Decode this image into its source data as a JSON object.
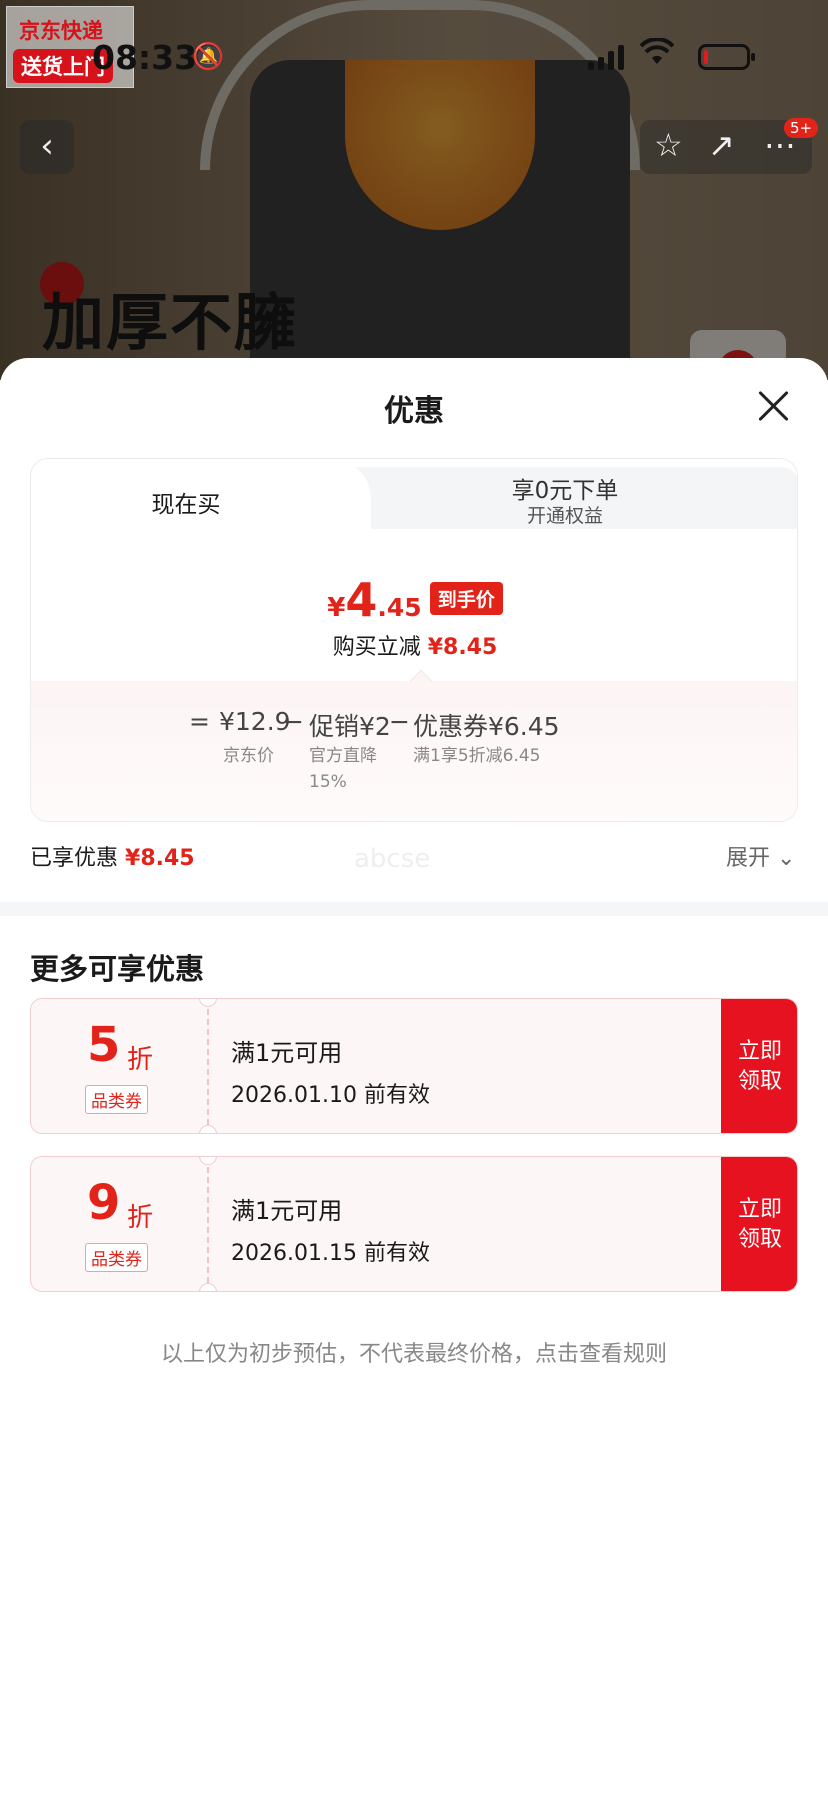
{
  "status_bar": {
    "time": "08:33"
  },
  "jd_badge": {
    "line1": "京东快递",
    "line2": "送货上门"
  },
  "product_banner": {
    "headline": "加厚不臃"
  },
  "cart_badge": "5+",
  "sheet": {
    "title": "优惠",
    "tabs": {
      "buy_now": "现在买",
      "zero_title": "享0元下单",
      "zero_sub": "开通权益"
    },
    "price": {
      "yen": "¥",
      "int": "4",
      "dec": ".45",
      "tag": "到手价"
    },
    "save_prefix": "购买立减",
    "save_amount": "¥8.45",
    "formula": {
      "eq": "=",
      "base": "¥12.9",
      "base_label": "京东价",
      "minus1": "−",
      "promo": "促销¥2",
      "promo_label_1": "官方直降",
      "promo_label_2": "15%",
      "minus2": "−",
      "coupon": "优惠券¥6.45",
      "coupon_label": "满1享5折减6.45"
    },
    "enjoyed_label": "已享优惠",
    "enjoyed_amount": "¥8.45",
    "expand_label": "展开",
    "watermark": "abcse",
    "more_title": "更多可享优惠",
    "coupons": [
      {
        "num": "5",
        "unit": "折",
        "category": "品类券",
        "condition": "满1元可用",
        "validity": "2026.01.10 前有效",
        "btn_1": "立即",
        "btn_2": "领取"
      },
      {
        "num": "9",
        "unit": "折",
        "category": "品类券",
        "condition": "满1元可用",
        "validity": "2026.01.15 前有效",
        "btn_1": "立即",
        "btn_2": "领取"
      }
    ],
    "note": "以上仅为初步预估，不代表最终价格，点击查看规则"
  },
  "colors": {
    "accent_red": "#e2231a",
    "coupon_bg": "#fcf6f6"
  },
  "icons": [
    "back-arrow-icon",
    "star-icon",
    "share-icon",
    "more-icon",
    "close-icon",
    "chevron-down-icon",
    "bell-mute-icon",
    "signal-icon",
    "wifi-icon",
    "battery-icon"
  ]
}
